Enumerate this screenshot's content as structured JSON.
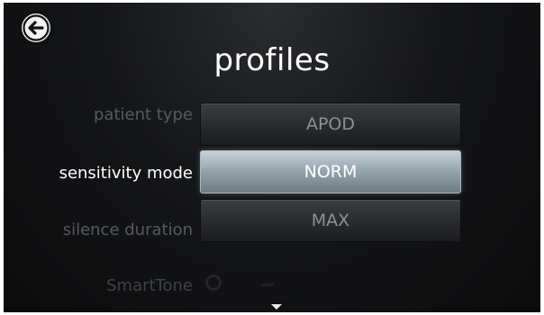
{
  "header": {
    "title": "profiles",
    "back_icon": "back-arrow-icon"
  },
  "settings": [
    {
      "label": "patient type",
      "option": "APOD"
    },
    {
      "label": "sensitivity mode",
      "option": "NORM"
    },
    {
      "label": "silence duration",
      "option": "MAX"
    },
    {
      "label": "SmartTone"
    }
  ],
  "footer": {
    "scroll_icon": "scroll-down-arrow-icon"
  },
  "colors": {
    "background": "#0b0b0c",
    "selected_button": "#93a2aa",
    "button": "#2b2d31",
    "dim_label": "#555a60"
  }
}
